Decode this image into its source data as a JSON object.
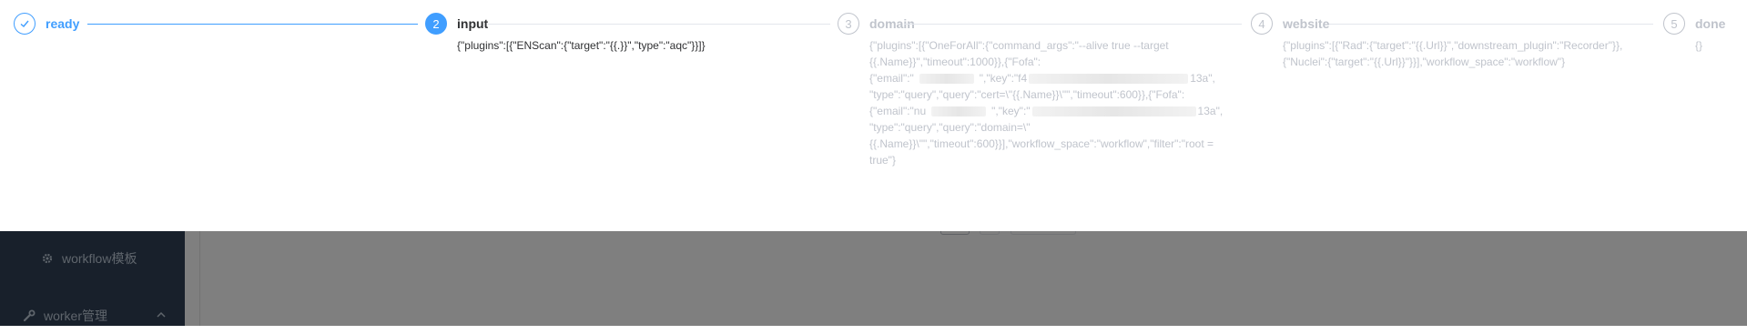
{
  "sidebar": {
    "workflow_template_label": "workflow模板",
    "worker_manage_label": "worker管理"
  },
  "steps": [
    {
      "index": "1",
      "title": "ready",
      "status": "done",
      "description": ""
    },
    {
      "index": "2",
      "title": "input",
      "status": "active",
      "description": "{\"plugins\":[{\"ENScan\":{\"target\":\"{{.}}\",\"type\":\"aqc\"}}]}"
    },
    {
      "index": "3",
      "title": "domain",
      "status": "wait",
      "description_lines": [
        "{\"plugins\":[{\"OneForAll\":{\"command_args\":\"--alive true --target",
        "{{.Name}}\",\"timeout\":1000}},{\"Fofa\":",
        "{\"email\":\"",
        "\",\"key\":\"f4",
        "13a\",",
        "\"type\":\"query\",\"query\":\"cert=\\\"{{.Name}}\\\"\",\"timeout\":600}},{\"Fofa\":",
        "{\"email\":\"nu",
        "\",\"key\":\"",
        "13a\",",
        "\"type\":\"query\",\"query\":\"domain=\\\"",
        "{{.Name}}\\\"\",\"timeout\":600}}],\"workflow_space\":\"workflow\",\"filter\":\"root =",
        "true\"}"
      ]
    },
    {
      "index": "4",
      "title": "website",
      "status": "wait",
      "description_lines": [
        "{\"plugins\":[{\"Rad\":{\"target\":\"{{.Url}}\",\"downstream_plugin\":\"Recorder\"}},",
        "{\"Nuclei\":{\"target\":\"{{.Url}}\"}}],\"workflow_space\":\"workflow\"}"
      ]
    },
    {
      "index": "5",
      "title": "done",
      "status": "wait",
      "description": "{}"
    }
  ],
  "icons": {
    "check": "check-icon",
    "gear": "gear-icon",
    "wrench": "wrench-icon",
    "chevron": "chevron-up-icon"
  },
  "colors": {
    "primary": "#409eff",
    "wait": "#c0c4cc",
    "text": "#303133",
    "sidebar": "#304156"
  }
}
